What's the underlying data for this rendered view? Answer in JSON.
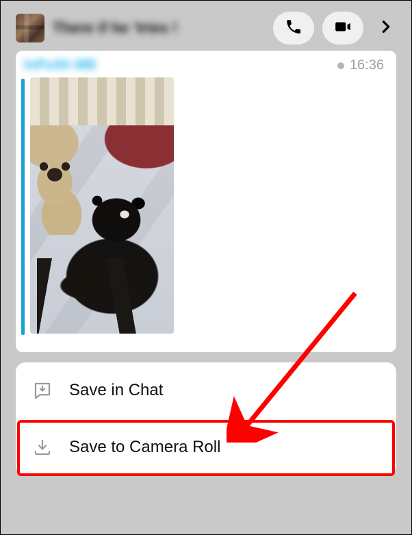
{
  "header": {
    "contact_name": "There if he 'tries !",
    "icons": {
      "call": "phone-icon",
      "video": "video-icon",
      "more": "chevron-right-icon"
    }
  },
  "message": {
    "sender_name": "InPuSh MB",
    "timestamp": "16:36",
    "image_alt": "Two pugs on a bed"
  },
  "menu": {
    "items": [
      {
        "label": "Save in Chat",
        "icon": "save-chat-icon"
      },
      {
        "label": "Save to Camera Roll",
        "icon": "download-icon"
      }
    ]
  }
}
